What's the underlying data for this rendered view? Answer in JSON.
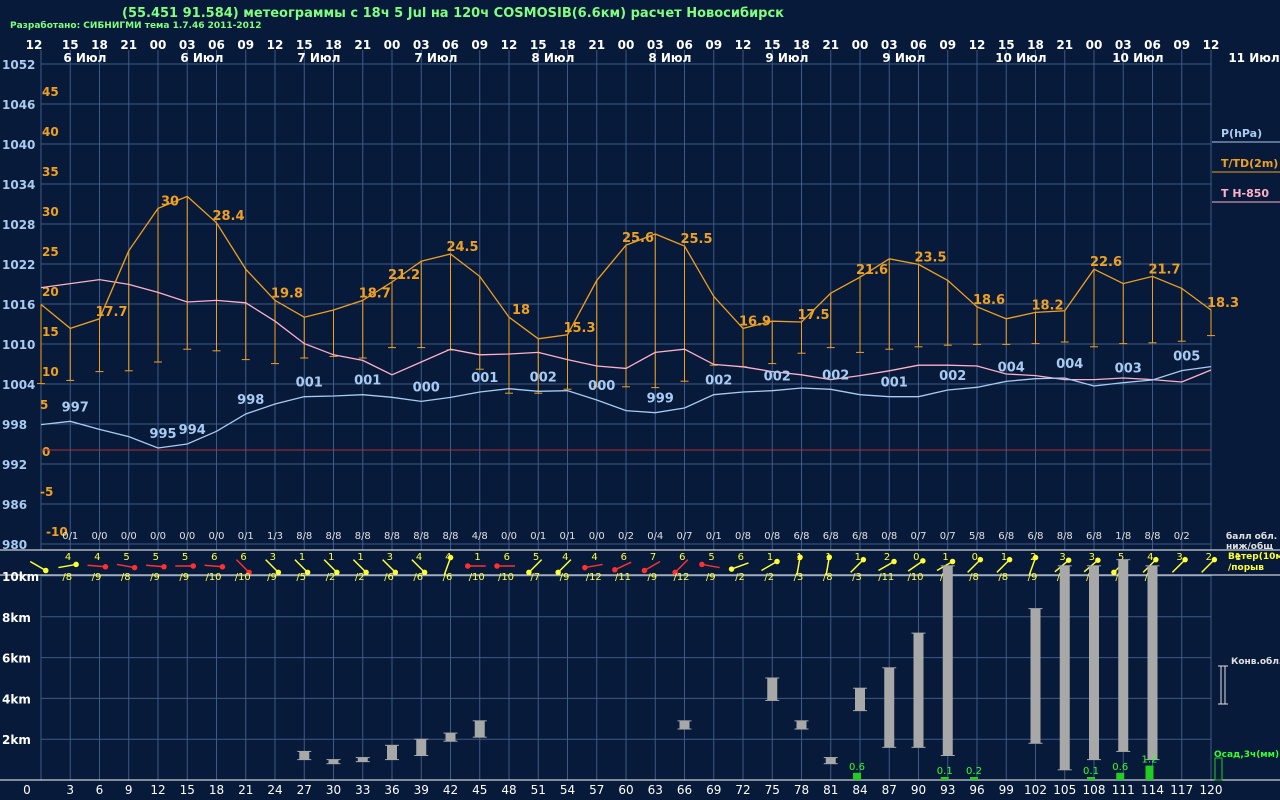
{
  "header": {
    "title": "(55.451 91.584) метеограммы с  18ч 5 Jul на 120ч COSMOSIB(6.6км) расчет Новосибирск",
    "credit": "Разработано: СИБНИГМИ тема 1.7.46 2011-2012"
  },
  "colors": {
    "background": "#071a3a",
    "grid": "#3e5a86",
    "pressure": "#a9cbf2",
    "temperature": "#f0a020",
    "t850": "#ffb0c8",
    "zero_line": "#b03030",
    "wind_light": "#ffff33",
    "wind_strong": "#ff3030",
    "cloud_bar": "#a8a8a8",
    "precip": "#22cc22",
    "precip_text": "#33ff33",
    "hour_text": "#ffffff",
    "cloud_text": "#e0e0e0"
  },
  "chart_data": {
    "type": "meteogram",
    "x_hours": [
      0,
      3,
      6,
      9,
      12,
      15,
      18,
      21,
      24,
      27,
      30,
      33,
      36,
      39,
      42,
      45,
      48,
      51,
      54,
      57,
      60,
      63,
      66,
      69,
      72,
      75,
      78,
      81,
      84,
      87,
      90,
      93,
      96,
      99,
      102,
      105,
      108,
      111,
      114,
      117,
      120
    ],
    "clock_hours": [
      "12",
      "15",
      "18",
      "21",
      "00",
      "03",
      "06",
      "09",
      "12",
      "15",
      "18",
      "21",
      "00",
      "03",
      "06",
      "09",
      "12",
      "15",
      "18",
      "21",
      "00",
      "03",
      "06",
      "09",
      "12",
      "15",
      "18",
      "21",
      "00",
      "03",
      "06",
      "09",
      "12",
      "15",
      "18",
      "21",
      "00",
      "03",
      "06",
      "09",
      "12"
    ],
    "date_labels": [
      {
        "text": "6 Июл",
        "hour": 4.5
      },
      {
        "text": "6 Июл",
        "hour": 16.5
      },
      {
        "text": "7 Июл",
        "hour": 28.5
      },
      {
        "text": "7 Июл",
        "hour": 40.5
      },
      {
        "text": "8 Июл",
        "hour": 52.5
      },
      {
        "text": "8 Июл",
        "hour": 64.5
      },
      {
        "text": "9 Июл",
        "hour": 76.5
      },
      {
        "text": "9 Июл",
        "hour": 88.5
      },
      {
        "text": "10 Июл",
        "hour": 100.5
      },
      {
        "text": "10 Июл",
        "hour": 112.5
      }
    ],
    "extra_date": "11 Июл",
    "pressure_axis": {
      "ticks": [
        980,
        986,
        992,
        998,
        1004,
        1010,
        1016,
        1022,
        1028,
        1034,
        1040,
        1046,
        1052
      ],
      "range": [
        980,
        1052
      ]
    },
    "temperature_axis": {
      "ticks": [
        -10,
        -5,
        0,
        5,
        10,
        15,
        20,
        25,
        30,
        35,
        40,
        45
      ],
      "range": [
        -10,
        45
      ]
    },
    "series": [
      {
        "name": "P(hPa)",
        "unit": "hPa",
        "axis": "pressure",
        "values": [
          997.9,
          998.4,
          997.2,
          996.1,
          994.4,
          995.0,
          996.9,
          999.5,
          1001.0,
          1002.1,
          1002.2,
          1002.4,
          1002.0,
          1001.4,
          1002.0,
          1002.8,
          1003.3,
          1002.9,
          1003.0,
          1001.6,
          1000.0,
          999.7,
          1000.4,
          1002.4,
          1002.8,
          1003.0,
          1003.4,
          1003.2,
          1002.4,
          1002.1,
          1002.1,
          1003.1,
          1003.5,
          1004.4,
          1004.8,
          1004.9,
          1003.7,
          1004.2,
          1004.6,
          1006.0,
          1006.6
        ],
        "labels": {
          "1": "997",
          "4": "995",
          "5": "994",
          "7": "998",
          "9": "001",
          "11": "001",
          "13": "000",
          "15": "001",
          "17": "002",
          "19": "000",
          "21": "999",
          "23": "002",
          "25": "002",
          "27": "002",
          "29": "001",
          "31": "002",
          "33": "004",
          "35": "004",
          "37": "003",
          "39": "005"
        }
      },
      {
        "name": "T/TD(2m)",
        "unit": "°C",
        "axis": "temperature",
        "values": [
          18.2,
          15.2,
          16.4,
          24.9,
          30.2,
          31.7,
          28.4,
          22.6,
          18.7,
          16.6,
          17.5,
          18.7,
          21.0,
          23.6,
          24.5,
          21.7,
          16.6,
          13.9,
          14.4,
          21.2,
          25.6,
          27.0,
          25.5,
          19.2,
          15.2,
          16.1,
          16.0,
          19.6,
          21.6,
          23.9,
          23.2,
          21.2,
          17.9,
          16.4,
          17.2,
          17.4,
          22.6,
          20.8,
          21.7,
          20.2,
          17.5
        ],
        "labels": {
          "2": "17.7",
          "4": "30",
          "6": "28.4",
          "8": "19.8",
          "11": "18.7",
          "12": "21.2",
          "14": "24.5",
          "16": "18",
          "18": "15.3",
          "20": "25.6",
          "22": "25.5",
          "24": "16.9",
          "26": "17.5",
          "28": "21.6",
          "30": "23.5",
          "32": "18.6",
          "34": "18.2",
          "36": "22.6",
          "38": "21.7",
          "40": "18.3"
        },
        "dew_point": [
          8.3,
          8.7,
          9.8,
          9.9,
          11.0,
          12.6,
          12.4,
          11.3,
          10.8,
          11.5,
          11.7,
          11.5,
          12.8,
          12.8,
          12.5,
          10.1,
          7.1,
          7.1,
          7.6,
          7.9,
          7.9,
          7.8,
          8.6,
          10.6,
          10.4,
          10.8,
          12.1,
          12.8,
          12.2,
          12.6,
          12.9,
          13.1,
          13.2,
          13.2,
          13.3,
          13.5,
          12.9,
          13.3,
          13.4,
          13.6,
          14.3
        ]
      },
      {
        "name": "T H-850",
        "unit": "°C",
        "axis": "temperature",
        "values": [
          20.3,
          20.8,
          21.3,
          20.7,
          19.7,
          18.5,
          18.7,
          18.4,
          16.1,
          13.3,
          11.9,
          11.2,
          9.4,
          11.0,
          12.6,
          11.9,
          12.0,
          12.2,
          11.3,
          10.5,
          10.2,
          12.2,
          12.6,
          10.7,
          10.4,
          9.8,
          9.4,
          8.8,
          9.3,
          9.9,
          10.6,
          10.6,
          10.5,
          9.5,
          9.3,
          8.8,
          8.8,
          9.0,
          8.8,
          8.5,
          10.0
        ]
      }
    ],
    "cloud_cover": [
      "0/1",
      "0/0",
      "0/0",
      "0/0",
      "0/0",
      "0/0",
      "0/1",
      "1/3",
      "8/8",
      "8/8",
      "8/8",
      "8/8",
      "8/8",
      "8/8",
      "4/8",
      "0/0",
      "0/1",
      "0/1",
      "0/0",
      "0/2",
      "0/4",
      "0/7",
      "0/1",
      "0/8",
      "0/8",
      "6/8",
      "6/8",
      "6/8",
      "0/8",
      "0/7",
      "0/7",
      "5/8",
      "6/8",
      "6/8",
      "8/8",
      "6/8",
      "1/8",
      "8/8",
      "0/2"
    ],
    "cloud_cover_hours": [
      3,
      6,
      9,
      12,
      15,
      18,
      21,
      24,
      27,
      30,
      33,
      36,
      39,
      42,
      45,
      48,
      51,
      54,
      57,
      60,
      63,
      66,
      69,
      72,
      75,
      78,
      81,
      84,
      87,
      90,
      93,
      96,
      99,
      102,
      105,
      108,
      111,
      114,
      117
    ],
    "wind": {
      "speed": [
        4,
        4,
        5,
        5,
        5,
        6,
        6,
        3,
        1,
        1,
        1,
        3,
        4,
        4,
        1,
        6,
        5,
        4,
        4,
        6,
        7,
        6,
        5,
        6,
        1,
        1,
        1,
        1,
        2,
        0,
        1,
        0,
        1,
        2,
        3,
        3,
        5,
        4,
        3,
        2,
        1
      ],
      "gust": [
        "/8",
        "/9",
        "/8",
        "/9",
        "/9",
        "/10",
        "/10",
        "/9",
        "/5",
        "/2",
        "/2",
        "/6",
        "/6",
        "/6",
        "/10",
        "/10",
        "/7",
        "/9",
        "/12",
        "/11",
        "/9",
        "/12",
        "/9",
        "/2",
        "/2",
        "/3",
        "/8",
        "/3",
        "/11",
        "/10",
        "/2",
        "/8",
        "/8",
        "/9",
        "/9",
        "/7",
        "/5",
        "/3"
      ],
      "gust_hours": [
        3,
        6,
        9,
        12,
        15,
        18,
        21,
        24,
        27,
        30,
        33,
        36,
        39,
        42,
        45,
        48,
        51,
        54,
        57,
        60,
        63,
        66,
        69,
        72,
        75,
        78,
        81,
        84,
        87,
        90,
        93,
        96,
        99,
        102,
        105,
        108,
        111,
        114,
        117,
        120
      ],
      "strong_hours": [
        6,
        9,
        12,
        15,
        18,
        21,
        45,
        48,
        57,
        60,
        63,
        66,
        69
      ],
      "direction_deg": [
        120,
        80,
        95,
        100,
        95,
        90,
        95,
        135,
        135,
        135,
        135,
        135,
        135,
        135,
        20,
        270,
        270,
        225,
        225,
        260,
        245,
        240,
        225,
        280,
        250,
        60,
        10,
        10,
        45,
        60,
        55,
        60,
        45,
        45,
        20,
        50,
        50,
        225,
        45,
        45,
        45
      ]
    },
    "cloud_column_km": [
      {
        "hour": 27,
        "bottom": 1.0,
        "top": 1.4
      },
      {
        "hour": 30,
        "bottom": 0.8,
        "top": 1.0
      },
      {
        "hour": 33,
        "bottom": 0.9,
        "top": 1.1
      },
      {
        "hour": 36,
        "bottom": 1.0,
        "top": 1.7
      },
      {
        "hour": 39,
        "bottom": 1.2,
        "top": 2.0
      },
      {
        "hour": 42,
        "bottom": 1.9,
        "top": 2.3
      },
      {
        "hour": 45,
        "bottom": 2.1,
        "top": 2.9
      },
      {
        "hour": 66,
        "bottom": 2.5,
        "top": 2.9
      },
      {
        "hour": 75,
        "bottom": 3.9,
        "top": 5.0
      },
      {
        "hour": 78,
        "bottom": 2.5,
        "top": 2.9
      },
      {
        "hour": 81,
        "bottom": 0.8,
        "top": 1.1
      },
      {
        "hour": 84,
        "bottom": 3.4,
        "top": 4.5
      },
      {
        "hour": 87,
        "bottom": 1.6,
        "top": 5.5
      },
      {
        "hour": 90,
        "bottom": 1.6,
        "top": 7.2
      },
      {
        "hour": 93,
        "bottom": 1.2,
        "top": 10.5
      },
      {
        "hour": 102,
        "bottom": 1.8,
        "top": 8.4
      },
      {
        "hour": 105,
        "bottom": 0.5,
        "top": 10.5
      },
      {
        "hour": 108,
        "bottom": 1.0,
        "top": 10.5
      },
      {
        "hour": 111,
        "bottom": 1.4,
        "top": 10.8
      },
      {
        "hour": 114,
        "bottom": 1.0,
        "top": 10.5
      }
    ],
    "precipitation_mm": [
      {
        "hour": 84,
        "value": 0.6
      },
      {
        "hour": 93,
        "value": 0.1
      },
      {
        "hour": 96,
        "value": 0.2
      },
      {
        "hour": 108,
        "value": 0.1
      },
      {
        "hour": 111,
        "value": 0.6
      },
      {
        "hour": 114,
        "value": 1.2
      }
    ],
    "cloud_height_ticks": [
      "2km",
      "4km",
      "6km",
      "8km",
      "10km"
    ],
    "legend": {
      "pressure": "P(hPa)",
      "temperature": "T/TD(2m)",
      "t850": "T H-850",
      "cloud_cover": "балл обл.",
      "cloud_cover_2": "ниж/общ",
      "wind": "Ветер(10м)",
      "wind_2": "/порыв",
      "convective": "Конв.обл.",
      "precip": "Осад,3ч(мм)"
    }
  }
}
